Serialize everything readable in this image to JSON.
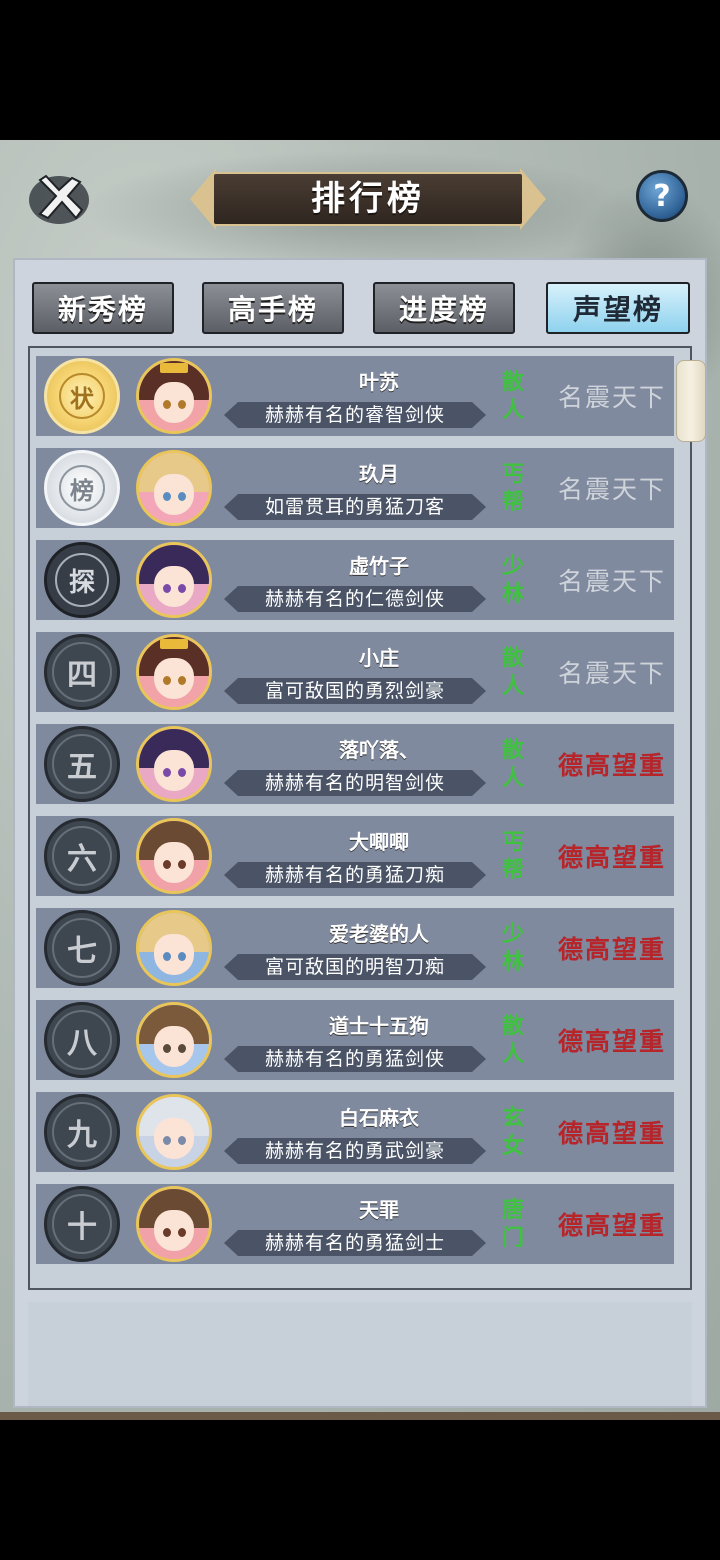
{
  "header": {
    "title": "排行榜",
    "help_symbol": "?"
  },
  "tabs": [
    {
      "label": "新秀榜",
      "active": false
    },
    {
      "label": "高手榜",
      "active": false
    },
    {
      "label": "进度榜",
      "active": false
    },
    {
      "label": "声望榜",
      "active": true
    }
  ],
  "rows": [
    {
      "rank": "状",
      "rank_style": "gold",
      "name": "叶苏",
      "title": "赫赫有名的睿智剑侠",
      "sect": "散人",
      "fame": "名震天下",
      "fame_style": "grey"
    },
    {
      "rank": "榜",
      "rank_style": "silver",
      "name": "玖月",
      "title": "如雷贯耳的勇猛刀客",
      "sect": "丐帮",
      "fame": "名震天下",
      "fame_style": "grey"
    },
    {
      "rank": "探",
      "rank_style": "dark",
      "name": "虚竹子",
      "title": "赫赫有名的仁德剑侠",
      "sect": "少林",
      "fame": "名震天下",
      "fame_style": "grey"
    },
    {
      "rank": "四",
      "rank_style": "num",
      "name": "小庄",
      "title": "富可敌国的勇烈剑豪",
      "sect": "散人",
      "fame": "名震天下",
      "fame_style": "grey"
    },
    {
      "rank": "五",
      "rank_style": "num",
      "name": "落吖落、",
      "title": "赫赫有名的明智剑侠",
      "sect": "散人",
      "fame": "德高望重",
      "fame_style": "red"
    },
    {
      "rank": "六",
      "rank_style": "num",
      "name": "大唧唧",
      "title": "赫赫有名的勇猛刀痴",
      "sect": "丐帮",
      "fame": "德高望重",
      "fame_style": "red"
    },
    {
      "rank": "七",
      "rank_style": "num",
      "name": "爱老婆的人",
      "title": "富可敌国的明智刀痴",
      "sect": "少林",
      "fame": "德高望重",
      "fame_style": "red"
    },
    {
      "rank": "八",
      "rank_style": "num",
      "name": "道士十五狗",
      "title": "赫赫有名的勇猛剑侠",
      "sect": "散人",
      "fame": "德高望重",
      "fame_style": "red"
    },
    {
      "rank": "九",
      "rank_style": "num",
      "name": "白石麻衣",
      "title": "赫赫有名的勇武剑豪",
      "sect": "玄女",
      "fame": "德高望重",
      "fame_style": "red"
    },
    {
      "rank": "十",
      "rank_style": "num",
      "name": "天罪",
      "title": "赫赫有名的勇猛剑士",
      "sect": "唐门",
      "fame": "德高望重",
      "fame_style": "red"
    }
  ],
  "my_rank": {
    "rank": "榜",
    "rank_style": "silver",
    "name": "玖月",
    "title": "如雷贯耳的勇猛刀客",
    "sect": "丐帮",
    "fame": "名震天下",
    "fame_style": "grey"
  }
}
